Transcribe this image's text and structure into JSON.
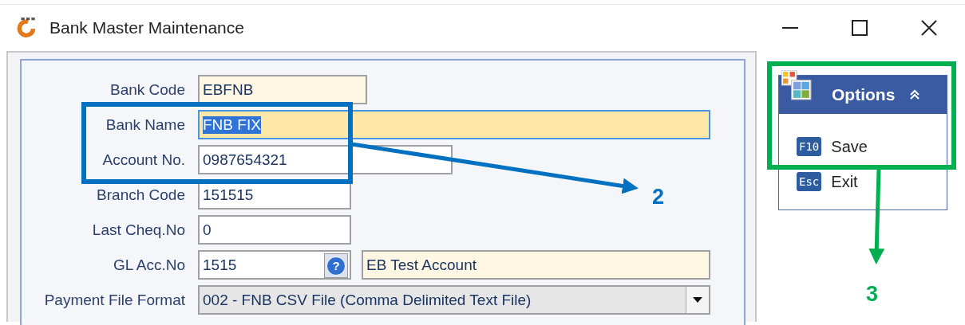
{
  "window": {
    "title": "Bank Master Maintenance"
  },
  "form": {
    "fields": [
      {
        "label": "Bank Code",
        "kind": "text",
        "value": "EBFNB",
        "readonly": true,
        "focused": false,
        "text_selected": false
      },
      {
        "label": "Bank Name",
        "kind": "text",
        "value": "FNB FIX",
        "readonly": false,
        "focused": true,
        "text_selected": true
      },
      {
        "label": "Account No.",
        "kind": "text",
        "value": "0987654321",
        "readonly": false,
        "focused": false,
        "text_selected": false
      },
      {
        "label": "Branch Code",
        "kind": "text",
        "value": "151515",
        "readonly": false,
        "focused": false,
        "text_selected": false
      },
      {
        "label": "Last Cheq.No",
        "kind": "text",
        "value": "0",
        "readonly": false,
        "focused": false,
        "text_selected": false
      },
      {
        "label": "GL Acc.No",
        "kind": "lookup",
        "value": "1515",
        "help_glyph": "?",
        "description": "EB Test Account",
        "readonly": false,
        "focused": false,
        "text_selected": false
      },
      {
        "label": "Payment File Format",
        "kind": "dropdown",
        "value": "002 - FNB CSV File (Comma Delimited Text File)",
        "readonly": false,
        "focused": false,
        "text_selected": false
      }
    ]
  },
  "options": {
    "title": "Options",
    "items": [
      {
        "key": "F10",
        "label": "Save"
      },
      {
        "key": "Esc",
        "label": "Exit"
      }
    ]
  },
  "annotations": [
    {
      "label": "2",
      "color": "#0070c0"
    },
    {
      "label": "3",
      "color": "#00b050"
    }
  ]
}
